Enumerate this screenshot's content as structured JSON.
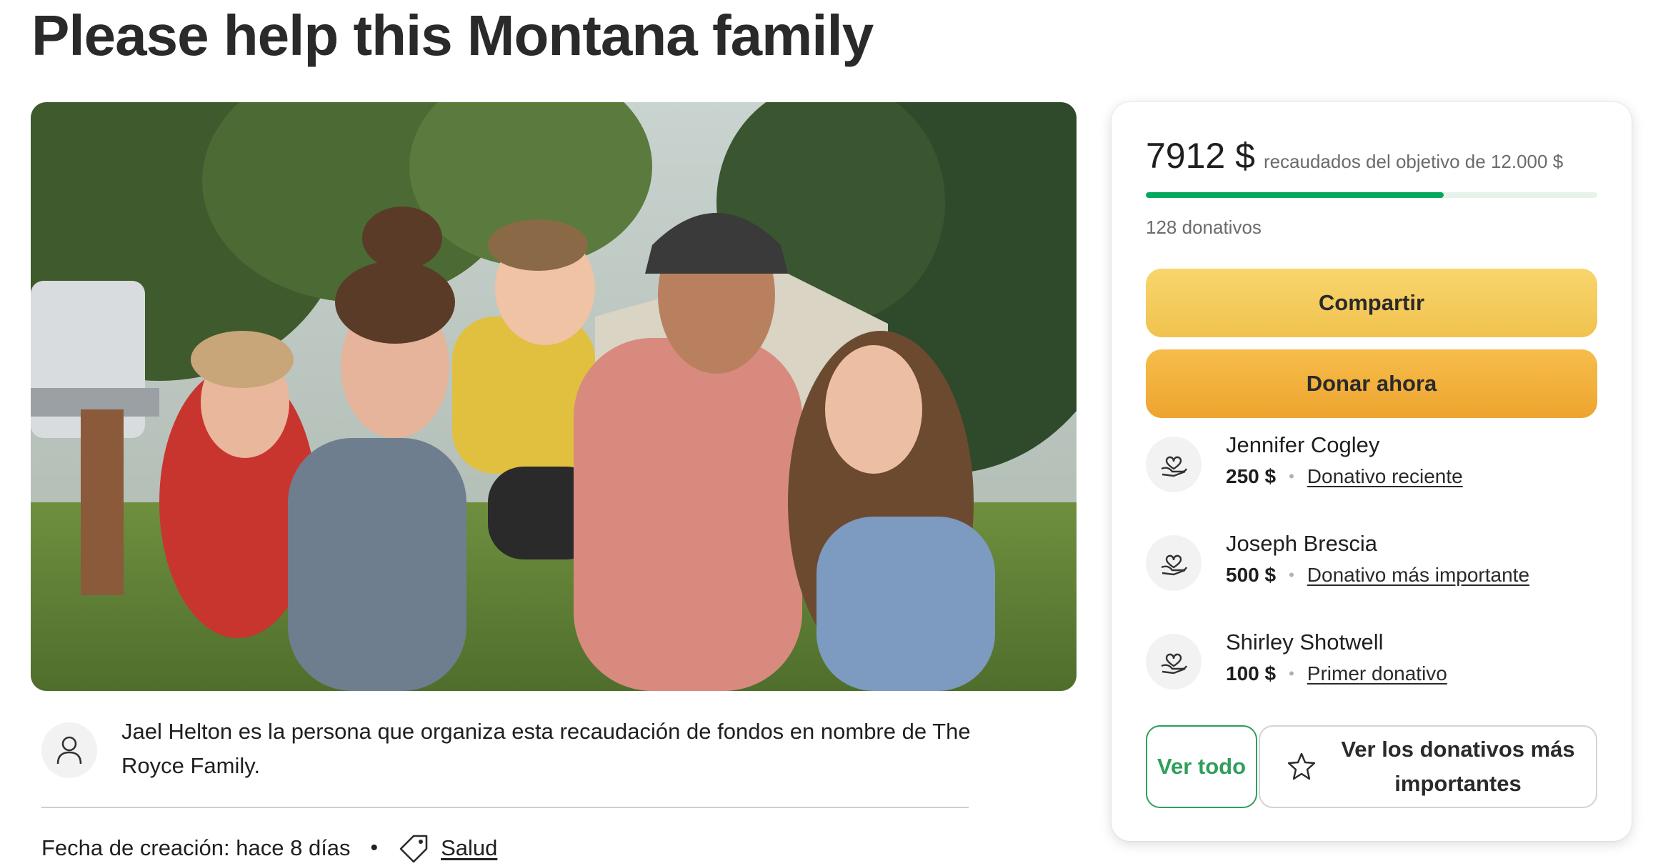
{
  "page_title": "Please help this Montana family",
  "organizer": {
    "text": "Jael Helton es la persona que organiza esta recaudación de fondos en nombre de The Royce Family.",
    "icon": "user-icon"
  },
  "meta": {
    "created": "Fecha de creación: hace 8 días",
    "separator": "•",
    "category": "Salud",
    "category_icon": "tag-icon"
  },
  "card": {
    "raised_amount": "7912 $",
    "raised_text": "recaudados del objetivo de 12.000 $",
    "progress_fraction": 0.66,
    "donation_count": "128 donativos",
    "share_label": "Compartir",
    "donate_label": "Donar ahora",
    "donors": [
      {
        "name": "Jennifer Cogley",
        "amount": "250 $",
        "label": "Donativo reciente"
      },
      {
        "name": "Joseph Brescia",
        "amount": "500 $",
        "label": "Donativo más importante"
      },
      {
        "name": "Shirley Shotwell",
        "amount": "100 $",
        "label": "Primer donativo"
      }
    ],
    "see_all_label": "Ver todo",
    "top_donations_label": "Ver los donativos más importantes",
    "donor_icon": "heart-hands-icon",
    "top_icon": "star-icon"
  },
  "colors": {
    "progress": "#02a95c",
    "share": "#f3c654",
    "donate": "#f0a935",
    "see_all": "#2f9e5c"
  }
}
